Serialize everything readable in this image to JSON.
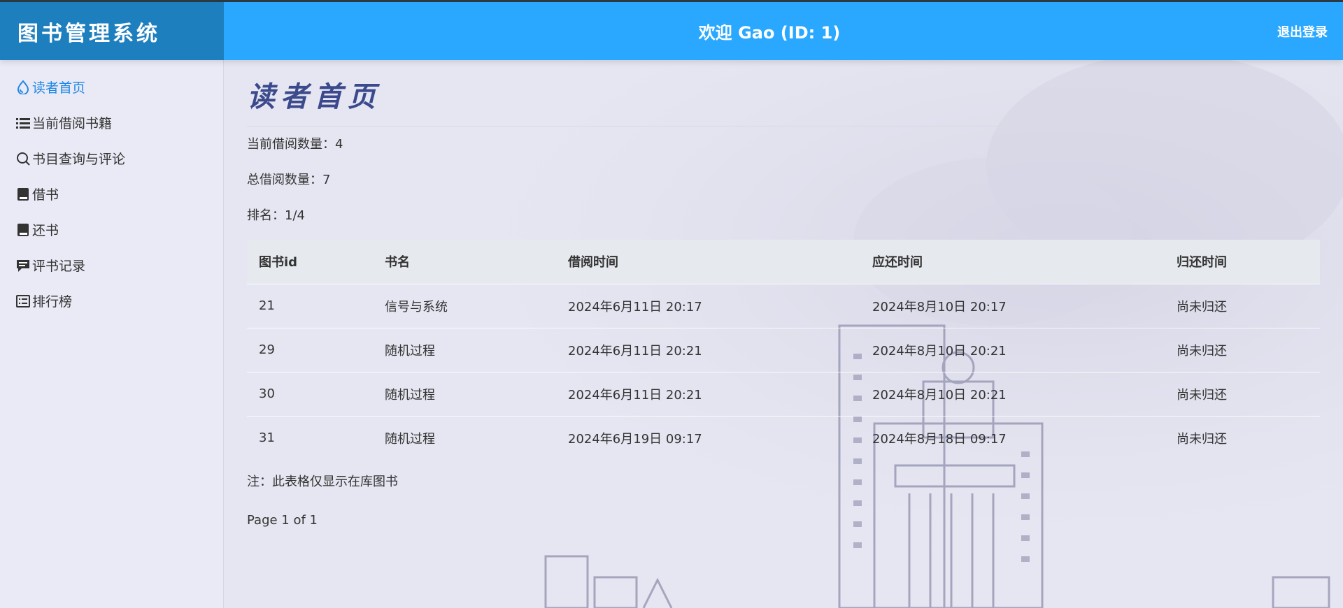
{
  "app": {
    "title": "图书管理系统"
  },
  "header": {
    "welcome": "欢迎 Gao (ID: 1)",
    "logout_label": "退出登录"
  },
  "sidebar": {
    "items": [
      {
        "label": "读者首页",
        "icon": "droplet-icon",
        "active": true
      },
      {
        "label": "当前借阅书籍",
        "icon": "list-icon",
        "active": false
      },
      {
        "label": "书目查询与评论",
        "icon": "search-icon",
        "active": false
      },
      {
        "label": "借书",
        "icon": "book-icon",
        "active": false
      },
      {
        "label": "还书",
        "icon": "book-icon",
        "active": false
      },
      {
        "label": "评书记录",
        "icon": "comment-icon",
        "active": false
      },
      {
        "label": "排行榜",
        "icon": "list-alt-icon",
        "active": false
      }
    ]
  },
  "main": {
    "page_title": "读者首页",
    "stats": {
      "current_borrow": "当前借阅数量：4",
      "total_borrow": "总借阅数量：7",
      "rank": "排名：1/4"
    },
    "table": {
      "headers": [
        "图书id",
        "书名",
        "借阅时间",
        "应还时间",
        "归还时间"
      ],
      "rows": [
        [
          "21",
          "信号与系统",
          "2024年6月11日 20:17",
          "2024年8月10日 20:17",
          "尚未归还"
        ],
        [
          "29",
          "随机过程",
          "2024年6月11日 20:21",
          "2024年8月10日 20:21",
          "尚未归还"
        ],
        [
          "30",
          "随机过程",
          "2024年6月11日 20:21",
          "2024年8月10日 20:21",
          "尚未归还"
        ],
        [
          "31",
          "随机过程",
          "2024年6月19日 09:17",
          "2024年8月18日 09:17",
          "尚未归还"
        ]
      ]
    },
    "note": "注：此表格仅显示在库图书",
    "pagination": "Page 1 of 1"
  },
  "colors": {
    "header_bg": "#2aa8ff",
    "brand_bg": "#1e7fbf",
    "active_nav": "#1e88e5",
    "title_color": "#3b4a8c",
    "page_bg": "#e6e6f2"
  }
}
